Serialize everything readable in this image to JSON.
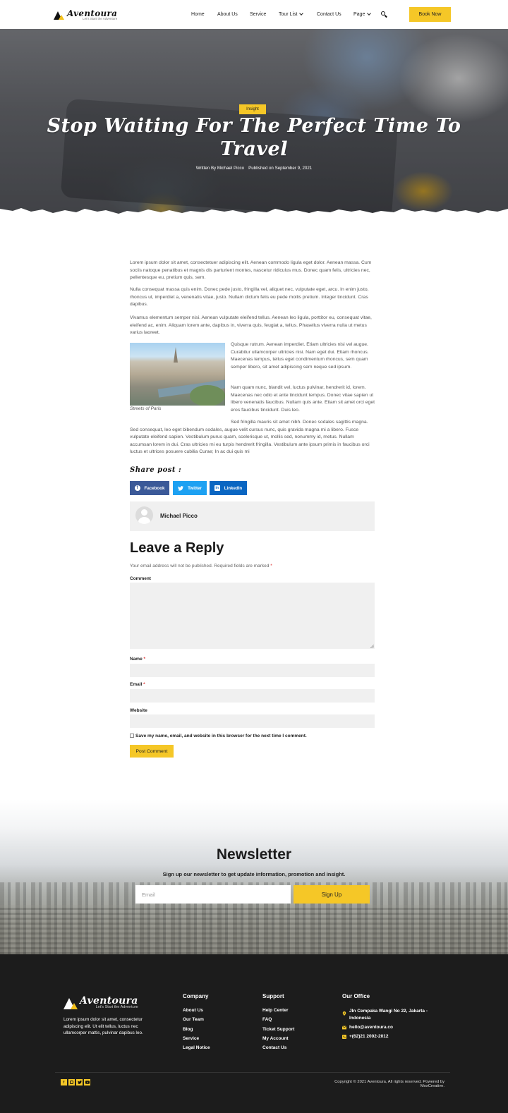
{
  "header": {
    "logo_name": "Aventoura",
    "logo_tagline": "Let's Start the Adventure",
    "nav": [
      {
        "label": "Home"
      },
      {
        "label": "About Us"
      },
      {
        "label": "Service"
      },
      {
        "label": "Tour List"
      },
      {
        "label": "Contact Us"
      },
      {
        "label": "Page"
      }
    ],
    "book_label": "Book Now"
  },
  "hero": {
    "category": "Insight",
    "title": "Stop Waiting For The Perfect Time To Travel",
    "author": "Written By Michael Picco",
    "published": "Published on September 9, 2021"
  },
  "article": {
    "paragraphs": [
      "Lorem ipsum dolor sit amet, consectetuer adipiscing elit. Aenean commodo ligula eget dolor. Aenean massa. Cum sociis natoque penatibus et magnis dis parturient montes, nascetur ridiculus mus. Donec quam felis, ultricies nec, pellentesque eu, pretium quis, sem.",
      "Nulla consequat massa quis enim. Donec pede justo, fringilla vel, aliquet nec, vulputate eget, arcu. In enim justo, rhoncus ut, imperdiet a, venenatis vitae, justo. Nullam dictum felis eu pede mollis pretium. Integer tincidunt. Cras dapibus.",
      "Vivamus elementum semper nisi. Aenean vulputate eleifend tellus. Aenean leo ligula, porttitor eu, consequat vitae, eleifend ac, enim. Aliquam lorem ante, dapibus in, viverra quis, feugiat a, tellus. Phasellus viverra nulla ut metus varius laoreet.",
      "Quisque rutrum. Aenean imperdiet. Etiam ultricies nisi vel augue. Curabitur ullamcorper ultricies nisi. Nam eget dui. Etiam rhoncus. Maecenas tempus, tellus eget condimentum rhoncus, sem quam semper libero, sit amet adipiscing sem neque sed ipsum.",
      "Nam quam nunc, blandit vel, luctus pulvinar, hendrerit id, lorem. Maecenas nec odio et ante tincidunt tempus. Donec vitae sapien ut libero venenatis faucibus. Nullam quis ante. Etiam sit amet orci eget eros faucibus tincidunt. Duis leo.",
      "Sed fringilla mauris sit amet nibh. Donec sodales sagittis magna. Sed consequat, leo eget bibendum sodales, augue velit cursus nunc, quis gravida magna mi a libero. Fusce vulputate eleifend sapien. Vestibulum purus quam, scelerisque ut, mollis sed, nonummy id, metus. Nullam accumsan lorem in dui. Cras ultricies mi eu turpis hendrerit fringilla. Vestibulum ante ipsum primis in faucibus orci luctus et ultrices posuere cubilia Curae; In ac dui quis mi"
    ],
    "image_caption": "Streets of Paris"
  },
  "share": {
    "title": "Share post :",
    "buttons": [
      {
        "label": "Facebook",
        "color": "#3b5998"
      },
      {
        "label": "Twitter",
        "color": "#1da1f2"
      },
      {
        "label": "LinkedIn",
        "color": "#0a66c2"
      }
    ]
  },
  "author_box": {
    "name": "Michael Picco"
  },
  "reply": {
    "title": "Leave a Reply",
    "note": "Your email address will not be published. Required fields are marked",
    "required_mark": "*",
    "comment_label": "Comment",
    "name_label": "Name",
    "email_label": "Email",
    "website_label": "Website",
    "save_label": "Save my name, email, and website in this browser for the next time I comment.",
    "submit_label": "Post Comment"
  },
  "newsletter": {
    "title": "Newsletter",
    "subtitle": "Sign up our newsletter to get update information, promotion and insight.",
    "placeholder": "Email",
    "button": "Sign Up"
  },
  "footer": {
    "logo_name": "Aventoura",
    "logo_tagline": "Let's Start the Adventure",
    "description": "Lorem ipsum dolor sit amet, consectetur adipiscing elit. Ut elit tellus, luctus nec ullamcorper mattis, pulvinar dapibus leo.",
    "company_title": "Company",
    "company_links": [
      "About Us",
      "Our Team",
      "Blog",
      "Service",
      "Legal Notice"
    ],
    "support_title": "Support",
    "support_links": [
      "Help Center",
      "FAQ",
      "Ticket Support",
      "My Account",
      "Contact Us"
    ],
    "office_title": "Our Office",
    "address": "Jln Cempaka Wangi No 22, Jakarta - Indonesia",
    "email": "hello@aventoura.co",
    "phone": "+(62)21 2002-2012",
    "social": [
      "facebook-icon",
      "instagram-icon",
      "twitter-icon",
      "youtube-icon"
    ],
    "copyright": "Copyright © 2021 Aventoura, All rights reserved. Powered by MoxCreative."
  },
  "colors": {
    "accent": "#f5c727",
    "footer_bg": "#1c1c1c",
    "text": "#555555"
  }
}
